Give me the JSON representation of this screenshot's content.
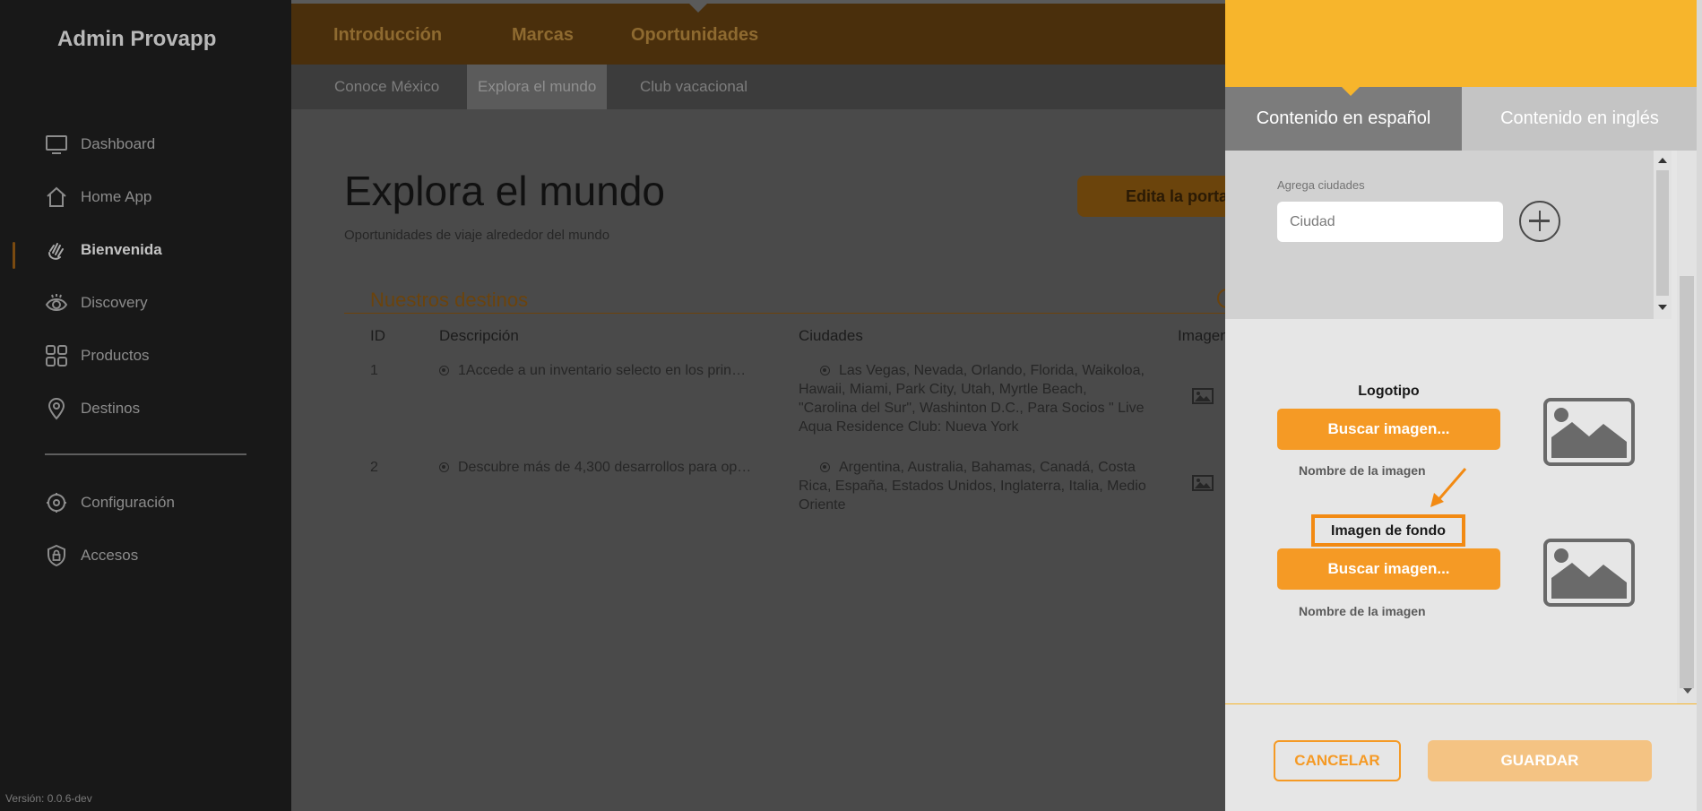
{
  "sidebar": {
    "brand": "Admin Provapp",
    "items": [
      {
        "label": "Dashboard",
        "icon": "monitor-icon"
      },
      {
        "label": "Home App",
        "icon": "home-icon"
      },
      {
        "label": "Bienvenida",
        "icon": "waving-hand-icon",
        "active": true
      },
      {
        "label": "Discovery",
        "icon": "eye-icon"
      },
      {
        "label": "Productos",
        "icon": "grid-icon"
      },
      {
        "label": "Destinos",
        "icon": "map-pin-icon"
      },
      {
        "label": "Configuración",
        "icon": "gear-icon"
      },
      {
        "label": "Accesos",
        "icon": "shield-lock-icon"
      }
    ],
    "version": "Versión: 0.0.6-dev"
  },
  "topnav": {
    "tabs": [
      "Introducción",
      "Marcas",
      "Oportunidades"
    ],
    "active_tab": "Oportunidades"
  },
  "subnav": {
    "tabs": [
      "Conoce México",
      "Explora el mundo",
      "Club vacacional"
    ],
    "active_tab": "Explora el mundo"
  },
  "main": {
    "title": "Explora el mundo",
    "subtitle": "Oportunidades de viaje alrededor del mundo",
    "edit_button": "Edita la portada",
    "section_title": "Nuestros destinos",
    "table": {
      "headers": [
        "ID",
        "Descripción",
        "Ciudades",
        "Imagen"
      ],
      "rows": [
        {
          "id": "1",
          "description": "1Accede a un inventario selecto en los prin…",
          "cities": "Las Vegas, Nevada, Orlando, Florida, Waikoloa, Hawaii, Miami, Park City, Utah, Myrtle Beach, \"Carolina del Sur\", Washinton D.C., Para Socios \" Live Aqua Residence Club: Nueva York"
        },
        {
          "id": "2",
          "description": "Descubre más de 4,300 desarrollos para op…",
          "cities": "Argentina, Australia, Bahamas, Canadá, Costa Rica, España, Estados Unidos, Inglaterra, Italia, Medio Oriente"
        }
      ]
    }
  },
  "panel": {
    "tabs": [
      "Contenido en español",
      "Contenido en inglés"
    ],
    "active_tab": "Contenido en español",
    "cities_label": "Agrega ciudades",
    "city_placeholder": "Ciudad",
    "logo_label": "Logotipo",
    "logo_button": "Buscar imagen...",
    "logo_filename": "Nombre de la imagen",
    "background_label": "Imagen de fondo",
    "background_button": "Buscar imagen...",
    "background_filename": "Nombre de la imagen",
    "cancel": "CANCELAR",
    "save": "GUARDAR"
  },
  "colors": {
    "accent": "#f7b52c",
    "button": "#f59a25",
    "highlight": "#f28a13",
    "sidebar_bg": "#181818"
  }
}
